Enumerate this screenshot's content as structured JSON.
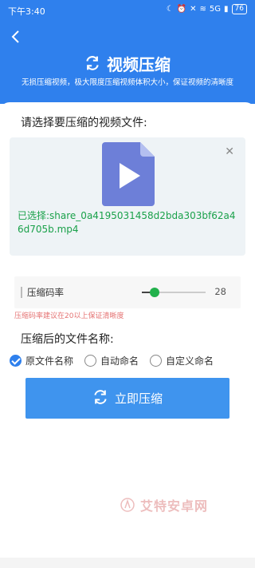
{
  "status_bar": {
    "time": "下午3:40",
    "network": "5G",
    "battery": "76"
  },
  "header": {
    "title": "视频压缩",
    "subtitle": "无损压缩视频，极大限度压缩视频体积大小，保证视频的清晰度"
  },
  "file_section": {
    "title": "请选择要压缩的视频文件:",
    "selected_text": "已选择:share_0a4195031458d2bda303bf62a46d705b.mp4"
  },
  "bitrate": {
    "label": "压缩码率",
    "value": "28",
    "slider_fraction": 0.2,
    "hint": "压缩码率建议在20以上保证清晰度"
  },
  "naming": {
    "title": "压缩后的文件名称:",
    "options": [
      {
        "label": "原文件名称",
        "checked": true
      },
      {
        "label": "自动命名",
        "checked": false
      },
      {
        "label": "自定义命名",
        "checked": false
      }
    ]
  },
  "action": {
    "compress_label": "立即压缩"
  },
  "watermark": {
    "text": "艾特安卓网"
  },
  "colors": {
    "primary": "#2f80ed",
    "button": "#3f94ee",
    "selected_text": "#1aa14a",
    "slider_thumb": "#22b14c",
    "hint": "#e57373",
    "file_icon": "#6d7fd8"
  },
  "icons": {
    "back": "back-arrow-icon",
    "title": "sync-icon",
    "file": "video-file-icon",
    "close": "close-icon",
    "button": "sync-icon"
  }
}
